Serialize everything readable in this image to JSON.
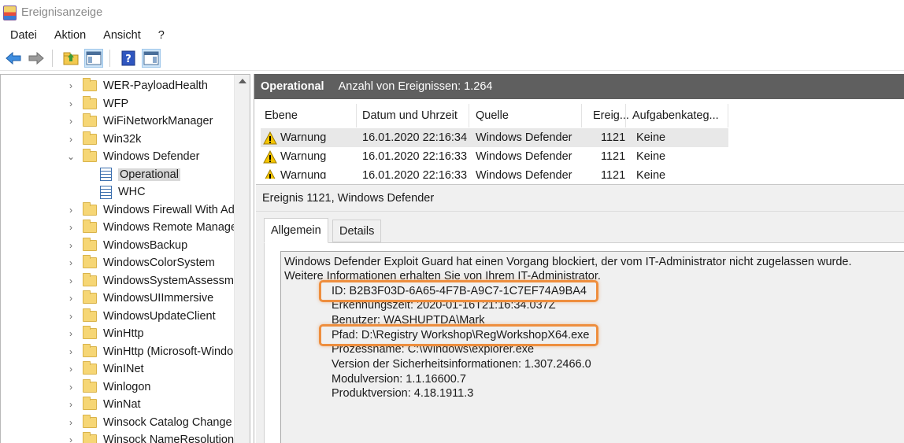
{
  "window": {
    "title": "Ereignisanzeige"
  },
  "menu": [
    "Datei",
    "Aktion",
    "Ansicht",
    "?"
  ],
  "toolbar": {
    "buttons": [
      "back-arrow-icon",
      "forward-arrow-icon",
      "up-folder-icon",
      "show-hide-tree-icon",
      "help-icon",
      "show-hide-action-icon"
    ]
  },
  "tree": {
    "items": [
      {
        "label": "WER-PayloadHealth",
        "type": "folder",
        "expanded": false
      },
      {
        "label": "WFP",
        "type": "folder",
        "expanded": false
      },
      {
        "label": "WiFiNetworkManager",
        "type": "folder",
        "expanded": false
      },
      {
        "label": "Win32k",
        "type": "folder",
        "expanded": false
      },
      {
        "label": "Windows Defender",
        "type": "folder",
        "expanded": true
      },
      {
        "label": "Operational",
        "type": "log",
        "selected": true
      },
      {
        "label": "WHC",
        "type": "log"
      },
      {
        "label": "Windows Firewall With Ad",
        "type": "folder",
        "expanded": false
      },
      {
        "label": "Windows Remote Manage",
        "type": "folder",
        "expanded": false
      },
      {
        "label": "WindowsBackup",
        "type": "folder",
        "expanded": false
      },
      {
        "label": "WindowsColorSystem",
        "type": "folder",
        "expanded": false
      },
      {
        "label": "WindowsSystemAssessme",
        "type": "folder",
        "expanded": false
      },
      {
        "label": "WindowsUIImmersive",
        "type": "folder",
        "expanded": false
      },
      {
        "label": "WindowsUpdateClient",
        "type": "folder",
        "expanded": false
      },
      {
        "label": "WinHttp",
        "type": "folder",
        "expanded": false
      },
      {
        "label": "WinHttp (Microsoft-Windo",
        "type": "folder",
        "expanded": false
      },
      {
        "label": "WinINet",
        "type": "folder",
        "expanded": false
      },
      {
        "label": "Winlogon",
        "type": "folder",
        "expanded": false
      },
      {
        "label": "WinNat",
        "type": "folder",
        "expanded": false
      },
      {
        "label": "Winsock Catalog Change",
        "type": "folder",
        "expanded": false
      },
      {
        "label": "Winsock NameResolution-",
        "type": "folder",
        "expanded": false
      }
    ]
  },
  "log_header": {
    "title": "Operational",
    "count": "Anzahl von Ereignissen: 1.264"
  },
  "events": {
    "columns": [
      "Ebene",
      "Datum und Uhrzeit",
      "Quelle",
      "Ereig...",
      "Aufgabenkateg..."
    ],
    "rows": [
      {
        "level": "Warnung",
        "date": "16.01.2020 22:16:34",
        "source": "Windows Defender",
        "id": "1121",
        "category": "Keine"
      },
      {
        "level": "Warnung",
        "date": "16.01.2020 22:16:33",
        "source": "Windows Defender",
        "id": "1121",
        "category": "Keine"
      },
      {
        "level": "Warnung",
        "date": "16.01.2020 22:16:33",
        "source": "Windows Defender",
        "id": "1121",
        "category": "Keine"
      }
    ]
  },
  "detail": {
    "title": "Ereignis 1121, Windows Defender",
    "tabs": [
      "Allgemein",
      "Details"
    ],
    "message": {
      "line1": "Windows Defender Exploit Guard hat einen Vorgang blockiert, der vom IT-Administrator nicht zugelassen wurde.",
      "line2": " Weitere Informationen erhalten Sie von Ihrem IT-Administrator.",
      "id": "ID: B2B3F03D-6A65-4F7B-A9C7-1C7EF74A9BA4",
      "detection_time": "Erkennungszeit: 2020-01-16T21:16:34.037Z",
      "user": "Benutzer: WASHUPTDA\\Mark",
      "path": "Pfad: D:\\Registry Workshop\\RegWorkshopX64.exe",
      "process": "Prozessname: C:\\Windows\\explorer.exe",
      "security_intel_version": "Version der Sicherheitsinformationen: 1.307.2466.0",
      "module_version": "Modulversion: 1.1.16600.7",
      "product_version": "Produktversion: 4.18.1911.3"
    }
  },
  "colors": {
    "highlight": "#ee8e3e",
    "header_bg": "#5f5f5f",
    "warning": "#f5c400"
  }
}
